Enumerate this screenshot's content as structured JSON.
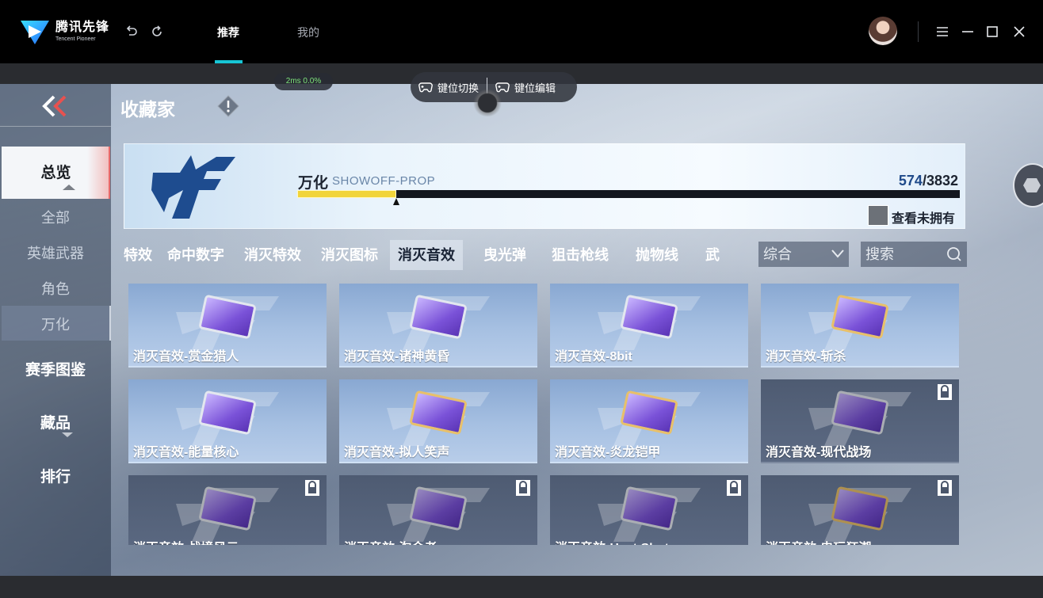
{
  "app": {
    "name_cn": "腾讯先锋",
    "name_en": "Tencent Pioneer",
    "nav_tabs": [
      {
        "label": "推荐",
        "active": true
      },
      {
        "label": "我的",
        "active": false
      }
    ],
    "accent_color": "#17c6d6"
  },
  "overlay": {
    "ping": "2ms  0.0%",
    "key_switch": "键位切换",
    "key_edit": "键位编辑"
  },
  "page": {
    "title": "收藏家"
  },
  "sidebar": {
    "overview": "总览",
    "sub_items": [
      "全部",
      "英雄武器",
      "角色",
      "万化"
    ],
    "selected_sub": "万化",
    "main_items": [
      "赛季图鉴",
      "藏品",
      "排行"
    ]
  },
  "banner": {
    "category": "万化",
    "subtitle": "SHOWOFF-PROP",
    "owned": "574",
    "separator": "/",
    "total": "3832",
    "progress_fraction": 0.15,
    "filter_label": "查看未拥有"
  },
  "filter_tabs": [
    {
      "label": "特效",
      "active": false
    },
    {
      "label": "命中数字",
      "active": false
    },
    {
      "label": "消灭特效",
      "active": false
    },
    {
      "label": "消灭图标",
      "active": false
    },
    {
      "label": "消灭音效",
      "active": true
    },
    {
      "label": "曳光弹",
      "active": false
    },
    {
      "label": "狙击枪线",
      "active": false
    },
    {
      "label": "抛物线",
      "active": false
    },
    {
      "label": "武",
      "active": false
    }
  ],
  "sort": {
    "value": "综合"
  },
  "search": {
    "placeholder": "搜索"
  },
  "items": [
    {
      "label": "消灭音效-赏金猎人",
      "locked": false,
      "frame": "silver"
    },
    {
      "label": "消灭音效-诸神黄昏",
      "locked": false,
      "frame": "silver"
    },
    {
      "label": "消灭音效-8bit",
      "locked": false,
      "frame": "silver"
    },
    {
      "label": "消灭音效-斩杀",
      "locked": false,
      "frame": "gold"
    },
    {
      "label": "消灭音效-能量核心",
      "locked": false,
      "frame": "silver"
    },
    {
      "label": "消灭音效-拟人笑声",
      "locked": false,
      "frame": "gold"
    },
    {
      "label": "消灭音效-炎龙铠甲",
      "locked": false,
      "frame": "gold"
    },
    {
      "label": "消灭音效-现代战场",
      "locked": true,
      "frame": "silver"
    },
    {
      "label": "消灭音效-战境风云",
      "locked": true,
      "frame": "silver"
    },
    {
      "label": "消灭音效-淘金者",
      "locked": true,
      "frame": "silver"
    },
    {
      "label": "消灭音效-Heat Shot",
      "locked": true,
      "frame": "silver"
    },
    {
      "label": "消灭音效-电玩狂潮",
      "locked": true,
      "frame": "gold"
    }
  ]
}
